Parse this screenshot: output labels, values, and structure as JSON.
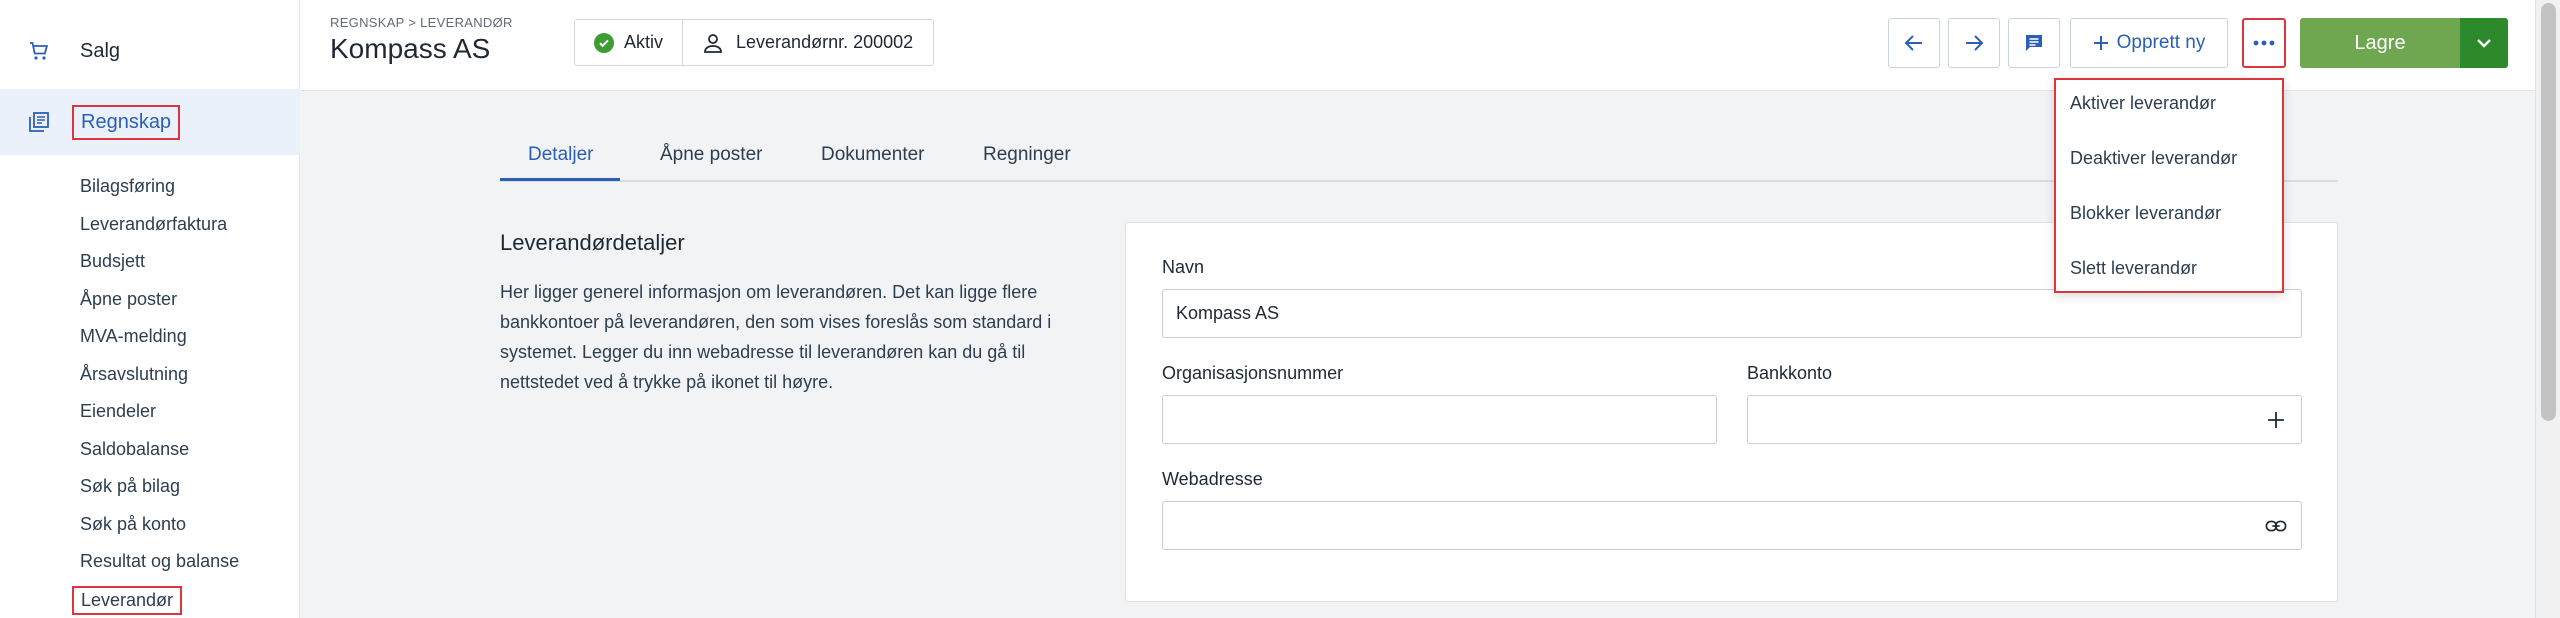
{
  "sidebar": {
    "salg_label": "Salg",
    "regnskap_label": "Regnskap",
    "items": [
      {
        "label": "Bilagsføring"
      },
      {
        "label": "Leverandørfaktura"
      },
      {
        "label": "Budsjett"
      },
      {
        "label": "Åpne poster"
      },
      {
        "label": "MVA-melding"
      },
      {
        "label": "Årsavslutning"
      },
      {
        "label": "Eiendeler"
      },
      {
        "label": "Saldobalanse"
      },
      {
        "label": "Søk på bilag"
      },
      {
        "label": "Søk på konto"
      },
      {
        "label": "Resultat og balanse"
      },
      {
        "label": "Leverandør"
      }
    ]
  },
  "header": {
    "breadcrumb": "REGNSKAP > LEVERANDØR",
    "title": "Kompass AS",
    "status": "Aktiv",
    "supplier_number": "Leverandørnr. 200002",
    "create_new": "Opprett ny",
    "save": "Lagre"
  },
  "tabs": [
    {
      "label": "Detaljer"
    },
    {
      "label": "Åpne poster"
    },
    {
      "label": "Dokumenter"
    },
    {
      "label": "Regninger"
    }
  ],
  "details": {
    "title": "Leverandørdetaljer",
    "description": "Her ligger generel informasjon om leverandøren. Det kan ligge flere bankkontoer på leverandøren, den som vises foreslås som standard i systemet. Legger du inn webadresse til leverandøren kan du gå til nettstedet ved å trykke på ikonet til høyre."
  },
  "form": {
    "name_label": "Navn",
    "name_value": "Kompass AS",
    "org_label": "Organisasjonsnummer",
    "org_value": "",
    "bank_label": "Bankkonto",
    "bank_value": "",
    "web_label": "Webadresse",
    "web_value": ""
  },
  "menu": {
    "items": [
      {
        "label": "Aktiver leverandør"
      },
      {
        "label": "Deaktiver leverandør"
      },
      {
        "label": "Blokker leverandør"
      },
      {
        "label": "Slett leverandør"
      }
    ]
  },
  "colors": {
    "accent": "#2b5fb4",
    "save_green": "#6ea74f",
    "highlight_red": "#d9363e"
  }
}
